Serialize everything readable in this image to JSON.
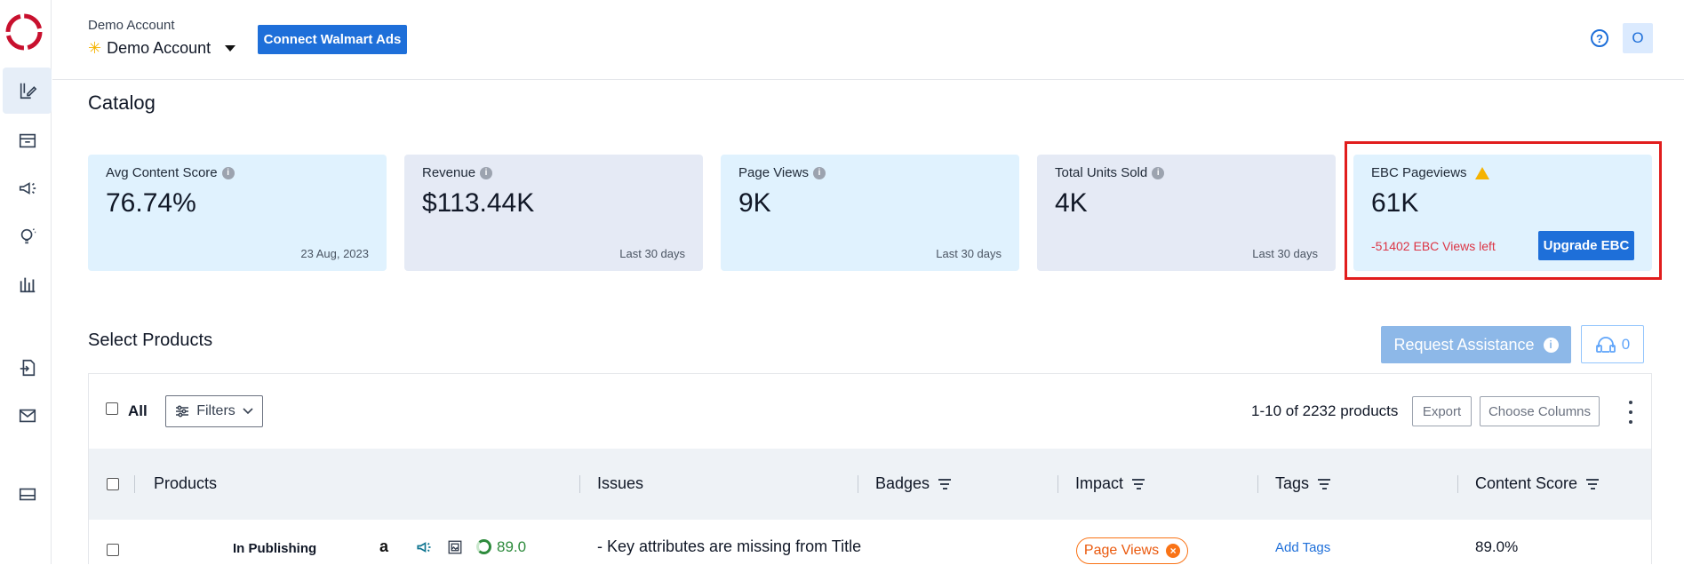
{
  "header": {
    "account_label": "Demo Account",
    "account_selected": "Demo Account",
    "connect_button": "Connect Walmart Ads",
    "help_icon": "?",
    "avatar_initial": "O"
  },
  "sidebar": {
    "items": [
      {
        "icon": "catalog-edit-icon",
        "active": true
      },
      {
        "icon": "inbox-icon",
        "active": false
      },
      {
        "icon": "megaphone-icon",
        "active": false
      },
      {
        "icon": "lightbulb-icon",
        "active": false
      },
      {
        "icon": "bar-chart-icon",
        "active": false
      },
      {
        "icon": "file-import-icon",
        "active": false
      },
      {
        "icon": "mail-icon",
        "active": false
      },
      {
        "icon": "card-icon",
        "active": false
      }
    ]
  },
  "page": {
    "title": "Catalog"
  },
  "cards": [
    {
      "label": "Avg Content Score",
      "value": "76.74%",
      "footer": "23 Aug, 2023"
    },
    {
      "label": "Revenue",
      "value": "$113.44K",
      "footer": "Last 30 days"
    },
    {
      "label": "Page Views",
      "value": "9K",
      "footer": "Last 30 days"
    },
    {
      "label": "Total Units Sold",
      "value": "4K",
      "footer": "Last 30 days"
    },
    {
      "label": "EBC Pageviews",
      "value": "61K",
      "views_left": "-51402 EBC Views left",
      "button": "Upgrade EBC"
    }
  ],
  "products": {
    "title": "Select Products",
    "request_button": "Request Assistance",
    "queue_count": "0",
    "all_label": "All",
    "filters_label": "Filters",
    "pagination": "1-10 of 2232 products",
    "export_button": "Export",
    "columns_button": "Choose Columns",
    "columns": [
      "Products",
      "Issues",
      "Badges",
      "Impact",
      "Tags",
      "Content Score"
    ],
    "rows": [
      {
        "status": "In Publishing",
        "amazon_glyph": "a",
        "score": "89.0",
        "issues": "- Key attributes are missing from Title",
        "impact": "Page Views",
        "tags": "Add Tags",
        "content_score": "89.0%"
      }
    ]
  },
  "colors": {
    "primary": "#1e6fd9",
    "card_light": "#e0f2fe",
    "card_gray": "#e5eaf5",
    "danger": "#dc3545",
    "highlight": "#e11d1d",
    "impact": "#f97316",
    "score_green": "#2e8b3d"
  }
}
